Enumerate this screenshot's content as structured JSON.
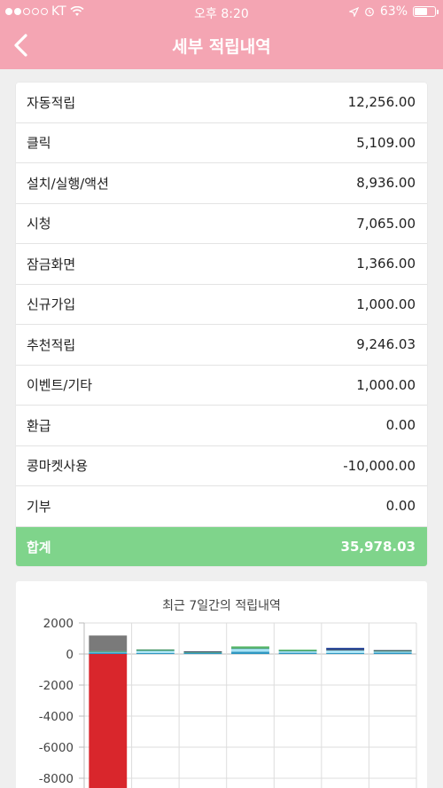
{
  "status_bar": {
    "carrier": "KT",
    "time": "오후 8:20",
    "battery": "63%",
    "battery_level": 0.63
  },
  "header": {
    "title": "세부 적립내역",
    "background": "#f4a5b3"
  },
  "rows": [
    {
      "label": "자동적립",
      "value": "12,256.00"
    },
    {
      "label": "클릭",
      "value": "5,109.00"
    },
    {
      "label": "설치/실행/액션",
      "value": "8,936.00"
    },
    {
      "label": "시청",
      "value": "7,065.00"
    },
    {
      "label": "잠금화면",
      "value": "1,366.00"
    },
    {
      "label": "신규가입",
      "value": "1,000.00"
    },
    {
      "label": "추천적립",
      "value": "9,246.03"
    },
    {
      "label": "이벤트/기타",
      "value": "1,000.00"
    },
    {
      "label": "환급",
      "value": "0.00"
    },
    {
      "label": "콩마켓사용",
      "value": "-10,000.00"
    },
    {
      "label": "기부",
      "value": "0.00"
    }
  ],
  "total": {
    "label": "합계",
    "value": "35,978.03",
    "color": "#7fd48b"
  },
  "chart_data": {
    "type": "bar",
    "title": "최근 7일간의 적립내역",
    "ylim": [
      -9000,
      2000
    ],
    "yticks": [
      2000,
      0,
      -2000,
      -4000,
      -6000,
      -8000
    ],
    "grid": true,
    "stacked": true,
    "days": 7,
    "series": [
      {
        "color": "#d9262c",
        "values": [
          -9000,
          0,
          0,
          0,
          0,
          0,
          0
        ]
      },
      {
        "color": "#2f97c1",
        "values": [
          100,
          60,
          80,
          150,
          80,
          60,
          90
        ]
      },
      {
        "color": "#a8e3f5",
        "values": [
          50,
          150,
          40,
          200,
          120,
          170,
          110
        ]
      },
      {
        "color": "#2e8b57",
        "values": [
          40,
          80,
          20,
          40,
          40,
          0,
          20
        ]
      },
      {
        "color": "#34495e",
        "values": [
          0,
          0,
          30,
          0,
          0,
          60,
          30
        ]
      },
      {
        "color": "#5aba6b",
        "values": [
          0,
          0,
          0,
          100,
          40,
          0,
          0
        ]
      },
      {
        "color": "#2c4a9c",
        "values": [
          0,
          0,
          0,
          0,
          0,
          110,
          0
        ]
      },
      {
        "color": "#7a7a7a",
        "values": [
          1000,
          0,
          0,
          0,
          0,
          0,
          0
        ]
      }
    ]
  }
}
